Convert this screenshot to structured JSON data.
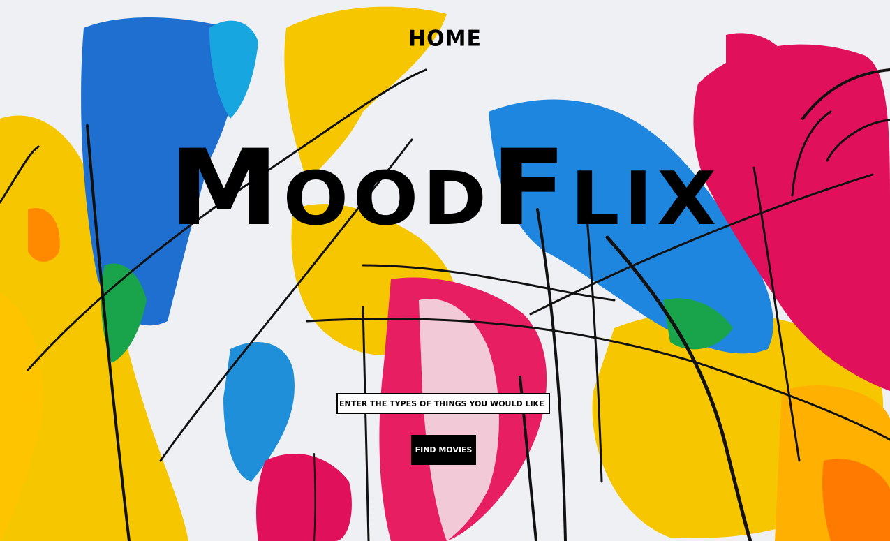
{
  "nav": {
    "home_label": "HOME"
  },
  "hero": {
    "title": "MoodFlix"
  },
  "search": {
    "placeholder": "ENTER THE TYPES OF THINGS YOU WOULD LIKE",
    "value": ""
  },
  "actions": {
    "find_label": "FIND MOVIES"
  },
  "background": {
    "description_icon": "abstract-paint-background",
    "colors": [
      "#f6c700",
      "#1f6fd1",
      "#e0105a",
      "#18a6e0",
      "#ff8a00",
      "#19a34a",
      "#000000"
    ]
  }
}
